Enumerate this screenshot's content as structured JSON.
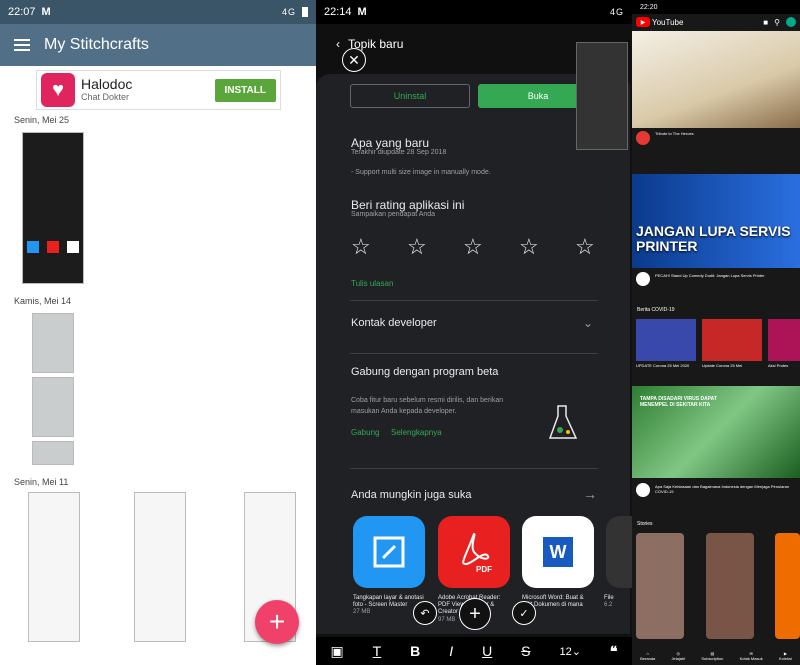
{
  "panel1": {
    "status_time": "22:07",
    "status_right": "4G",
    "app_title": "My Stitchcrafts",
    "ad": {
      "title": "Halodoc",
      "subtitle": "Chat Dokter",
      "button": "INSTALL"
    },
    "dates": [
      "Senin, Mei 25",
      "Kamis, Mei 14",
      "Senin, Mei 11"
    ],
    "fab": "+"
  },
  "panel2": {
    "status_time": "22:14",
    "status_right": "4G",
    "header_title": "Topik baru",
    "uninstall": "Uninstal",
    "open": "Buka",
    "whats_new_title": "Apa yang baru",
    "whats_new_sub": "Terakhir diupdate 28 Sep 2018",
    "whats_new_body": "- Support multi size image in manually mode.",
    "rate_title": "Beri rating aplikasi ini",
    "rate_sub": "Sampaikan pendapat Anda",
    "write_review": "Tulis ulasan",
    "contact_dev": "Kontak developer",
    "beta_title": "Gabung dengan program beta",
    "beta_body": "Coba fitur baru sebelum resmi dirilis, dan berikan masukan Anda kepada developer.",
    "beta_join": "Gabung",
    "beta_more": "Selengkapnya",
    "suggest_title": "Anda mungkin juga suka",
    "apps": [
      {
        "name": "Tangkapan layar & anotasi foto - Screen Master",
        "size": "27 MB",
        "color": "#2196f3"
      },
      {
        "name": "Adobe Acrobat Reader: PDF Viewer, Editor & Creator",
        "size": "97 MB",
        "color": "#e8201f"
      },
      {
        "name": "Microsoft Word: Buat & Edit Dokumen di mana pun",
        "size": "",
        "color": "#ffffff"
      }
    ],
    "app_partial_name": "File",
    "app_partial_size": "6.2"
  },
  "panel3": {
    "status_time": "22:20",
    "logo": "YouTube",
    "video1_title": "Tribute to The Heroes",
    "video1_channel": "",
    "video2_thumb_text": "JANGAN LUPA SERVIS PRINTER",
    "video2_title": "PECAH! Stand Up Comedy Dodit: Jangan Lupa Servis Printer",
    "section_title": "Berita COVID-19",
    "mini_titles": [
      "UPDATE Corona 25 Mei 2020",
      "Update Corona 25 Mei",
      "Aksi Protes"
    ],
    "video3_thumb_text": "TAMPA DISADARI VIRUS DAPAT MENEMPEL DI SEKITAR KITA",
    "video3_title": "Apa Saja Kebiasaan dan Bagaimana Indonesia dengan Menjaga Penularan COVID-19",
    "shorts_title": "Stories",
    "nav": [
      "Beranda",
      "Jelajahi",
      "Subscription",
      "Kotak Masuk",
      "Koleksi"
    ],
    "short_labels": [
      "",
      "",
      ""
    ]
  }
}
